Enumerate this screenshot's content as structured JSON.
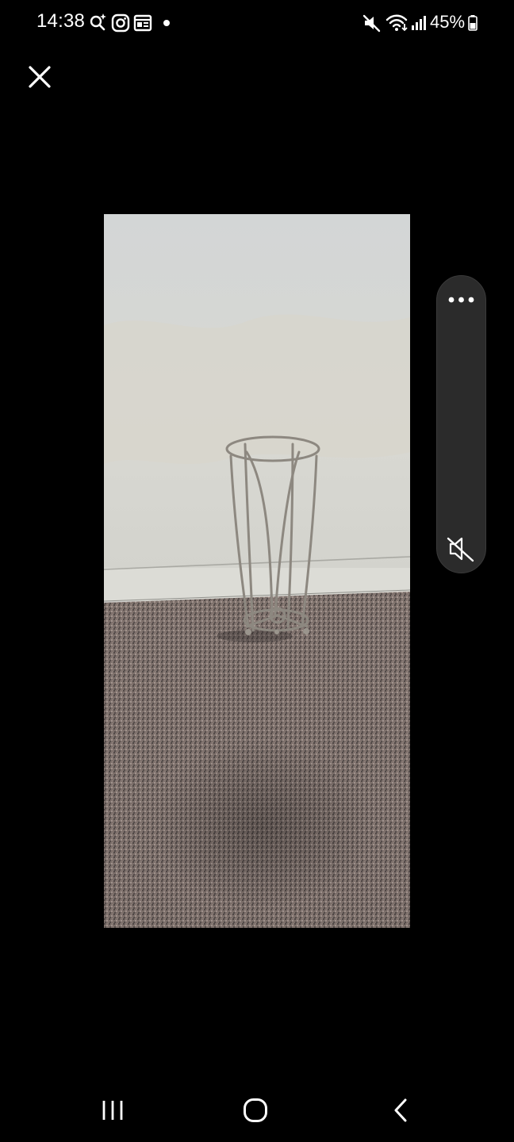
{
  "status_bar": {
    "time": "14:38",
    "battery_percent": "45%",
    "left_icons": [
      "search-sparkle-icon",
      "instagram-icon",
      "news-icon",
      "dot-icon"
    ],
    "right_icons": [
      "mute-icon",
      "wifi-icon",
      "signal-icon",
      "battery-icon"
    ]
  },
  "viewer": {
    "close_icon": "close-icon",
    "more_icon": "more-horizontal-icon",
    "mute_icon": "volume-off-icon"
  },
  "navigation": {
    "icons": [
      "recent-apps-icon",
      "home-icon",
      "back-icon"
    ]
  }
}
